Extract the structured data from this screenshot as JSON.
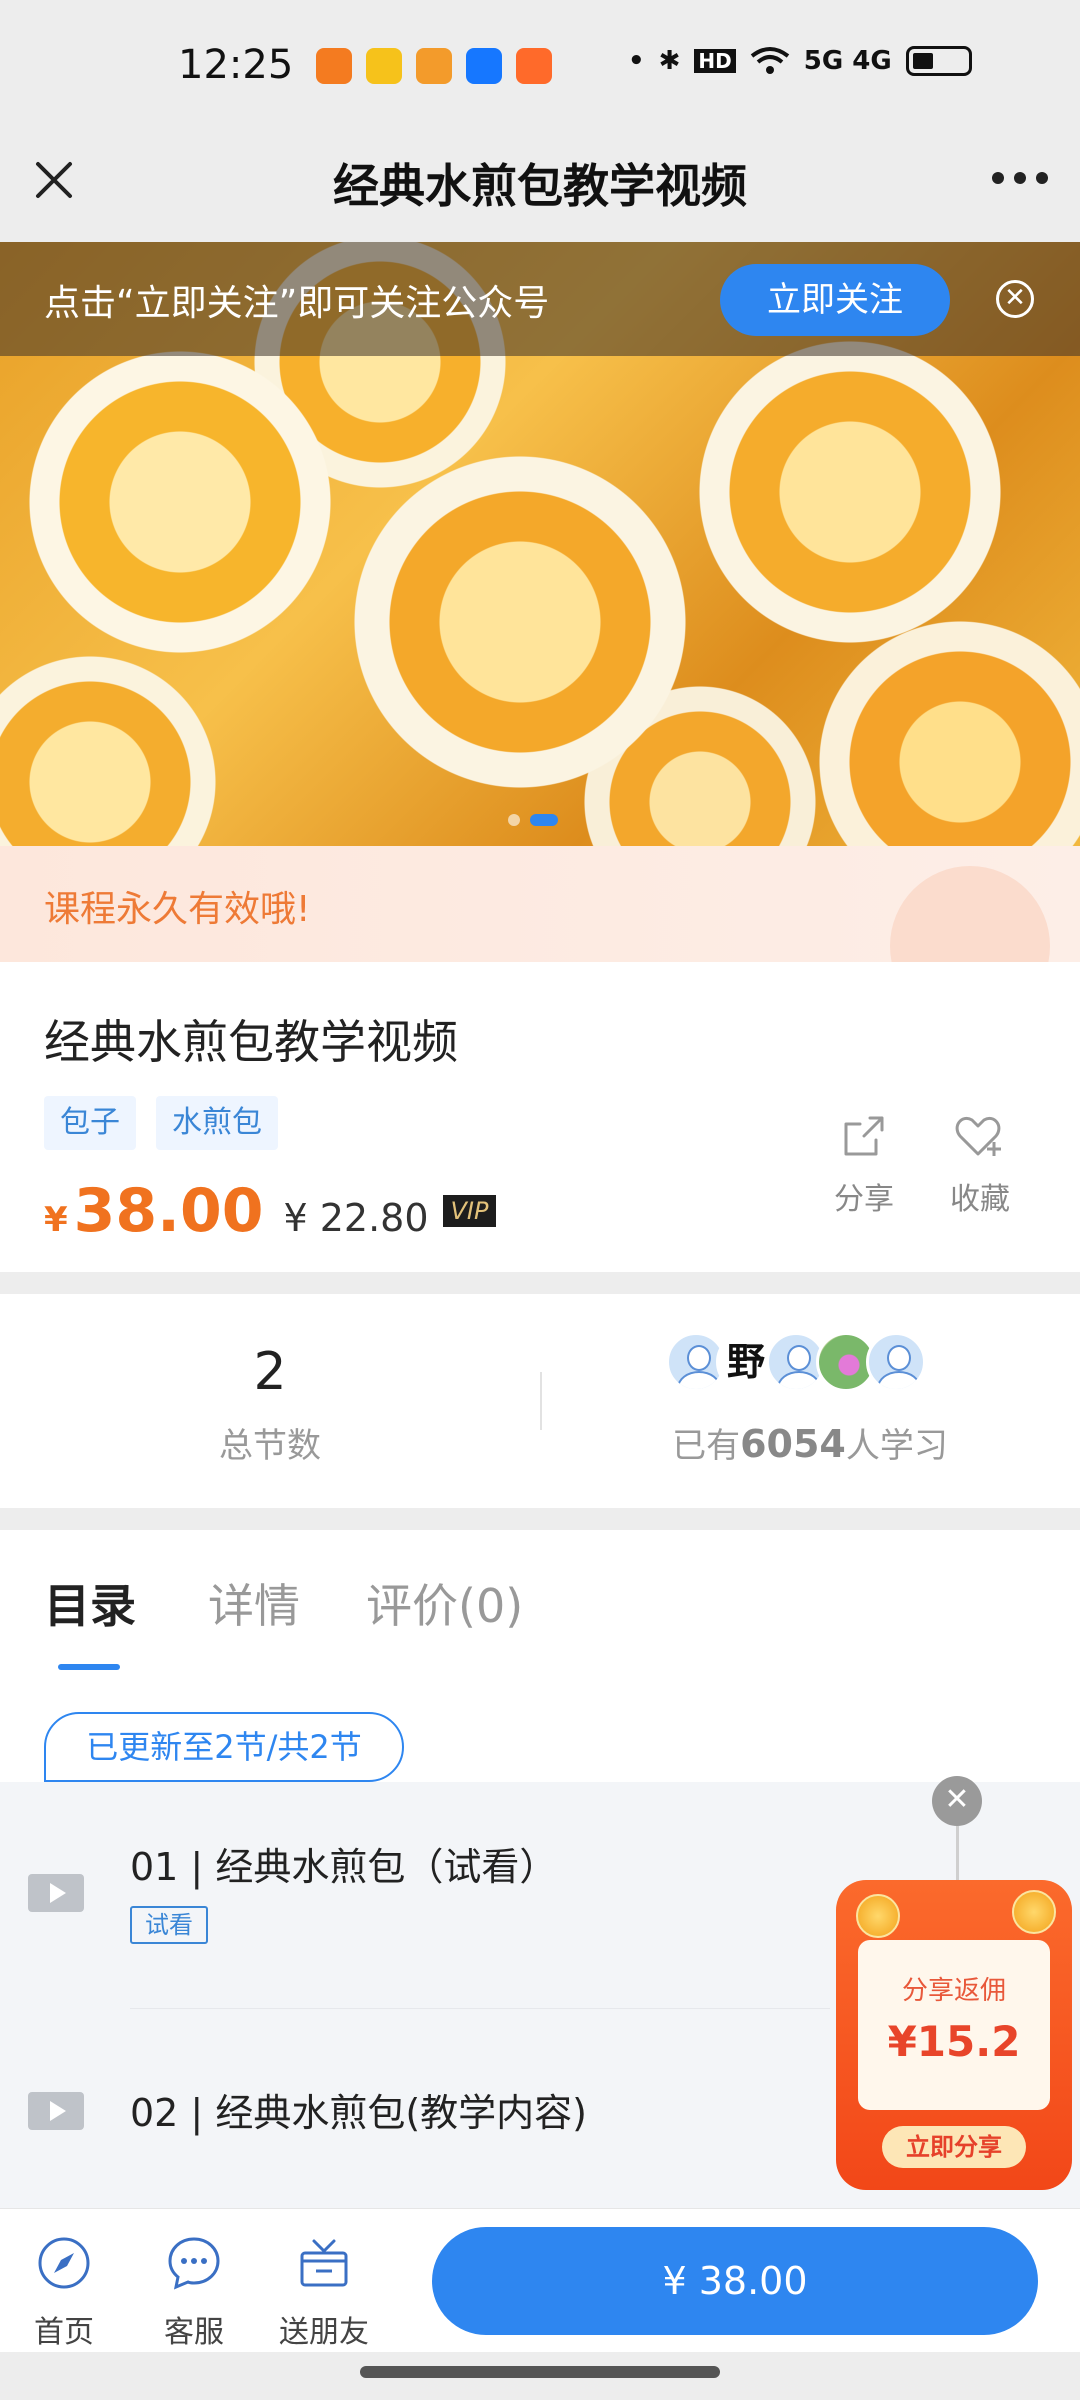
{
  "status": {
    "time": "12:25",
    "indicators": "5G 4G",
    "hd_label": "HD"
  },
  "nav": {
    "title": "经典水煎包教学视频"
  },
  "banner": {
    "follow_text": "点击“立即关注”即可关注公众号",
    "follow_button": "立即关注"
  },
  "notice": "课程永久有效哦!",
  "product": {
    "title": "经典水煎包教学视频",
    "tags": [
      "包子",
      "水煎包"
    ],
    "currency": "¥",
    "price": "38.00",
    "vip_price": "¥ 22.80",
    "vip_badge": "VIP",
    "share_label": "分享",
    "favorite_label": "收藏"
  },
  "stats": {
    "total_lessons": "2",
    "total_lessons_label": "总节数",
    "learners_prefix": "已有",
    "learners_count": "6054",
    "learners_suffix": "人学习",
    "avatar_ink_char": "野"
  },
  "tabs": [
    {
      "label": "目录",
      "active": true
    },
    {
      "label": "详情",
      "active": false
    },
    {
      "label": "评价(0)",
      "active": false
    }
  ],
  "catalog": {
    "update_status": "已更新至2节/共2节",
    "lessons": [
      {
        "title": "01 | 经典水煎包（试看）",
        "badge": "试看"
      },
      {
        "title": "02 | 经典水煎包(教学内容)"
      }
    ]
  },
  "promo": {
    "label": "分享返佣",
    "amount": "¥15.2",
    "button": "立即分享"
  },
  "bottom": {
    "home": "首页",
    "service": "客服",
    "gift": "送朋友",
    "buy": "¥ 38.00"
  },
  "colors": {
    "accent": "#2e86f0",
    "price": "#f0721f",
    "notice": "#ee7a36"
  }
}
